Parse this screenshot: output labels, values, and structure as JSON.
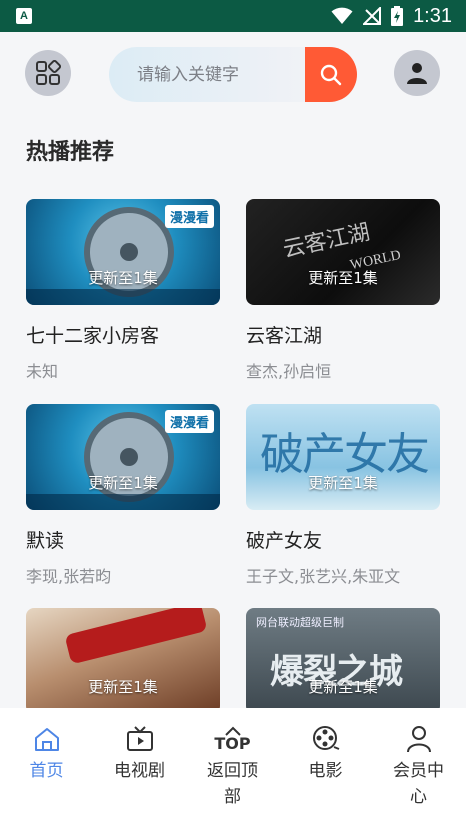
{
  "status_bar": {
    "time": "1:31",
    "app_icon": "A"
  },
  "header": {
    "search_placeholder": "请输入关键字"
  },
  "section": {
    "title": "热播推荐"
  },
  "videos": [
    {
      "title": "七十二家小房客",
      "subtitle": "未知",
      "badge": "更新至1集",
      "logo": "漫漫看"
    },
    {
      "title": "云客江湖",
      "subtitle": "查杰,孙启恒",
      "badge": "更新至1集",
      "art_text_1": "云客江湖",
      "art_text_2": "WORLD"
    },
    {
      "title": "默读",
      "subtitle": "李现,张若昀",
      "badge": "更新至1集",
      "logo": "漫漫看"
    },
    {
      "title": "破产女友",
      "subtitle": "王子文,张艺兴,朱亚文",
      "badge": "更新至1集",
      "art_text": "破产女友"
    },
    {
      "title": "",
      "subtitle": "",
      "badge": "更新至1集"
    },
    {
      "title": "",
      "subtitle": "",
      "badge": "更新至1集",
      "art_text": "爆裂之城",
      "art_top": "网台联动超级巨制"
    }
  ],
  "tabbar": {
    "items": [
      {
        "label": "首页",
        "icon": "home-icon",
        "active": true
      },
      {
        "label": "电视剧",
        "icon": "tv-icon",
        "active": false
      },
      {
        "label": "返回顶部",
        "icon": "back-to-top-icon",
        "icon_text": "TOP",
        "active": false
      },
      {
        "label": "电影",
        "icon": "film-reel-icon",
        "active": false
      },
      {
        "label": "会员中心",
        "icon": "user-icon",
        "active": false
      }
    ]
  },
  "colors": {
    "accent": "#4e86e6",
    "search_button": "#ff5a35",
    "status_bar": "#0c5a44"
  }
}
